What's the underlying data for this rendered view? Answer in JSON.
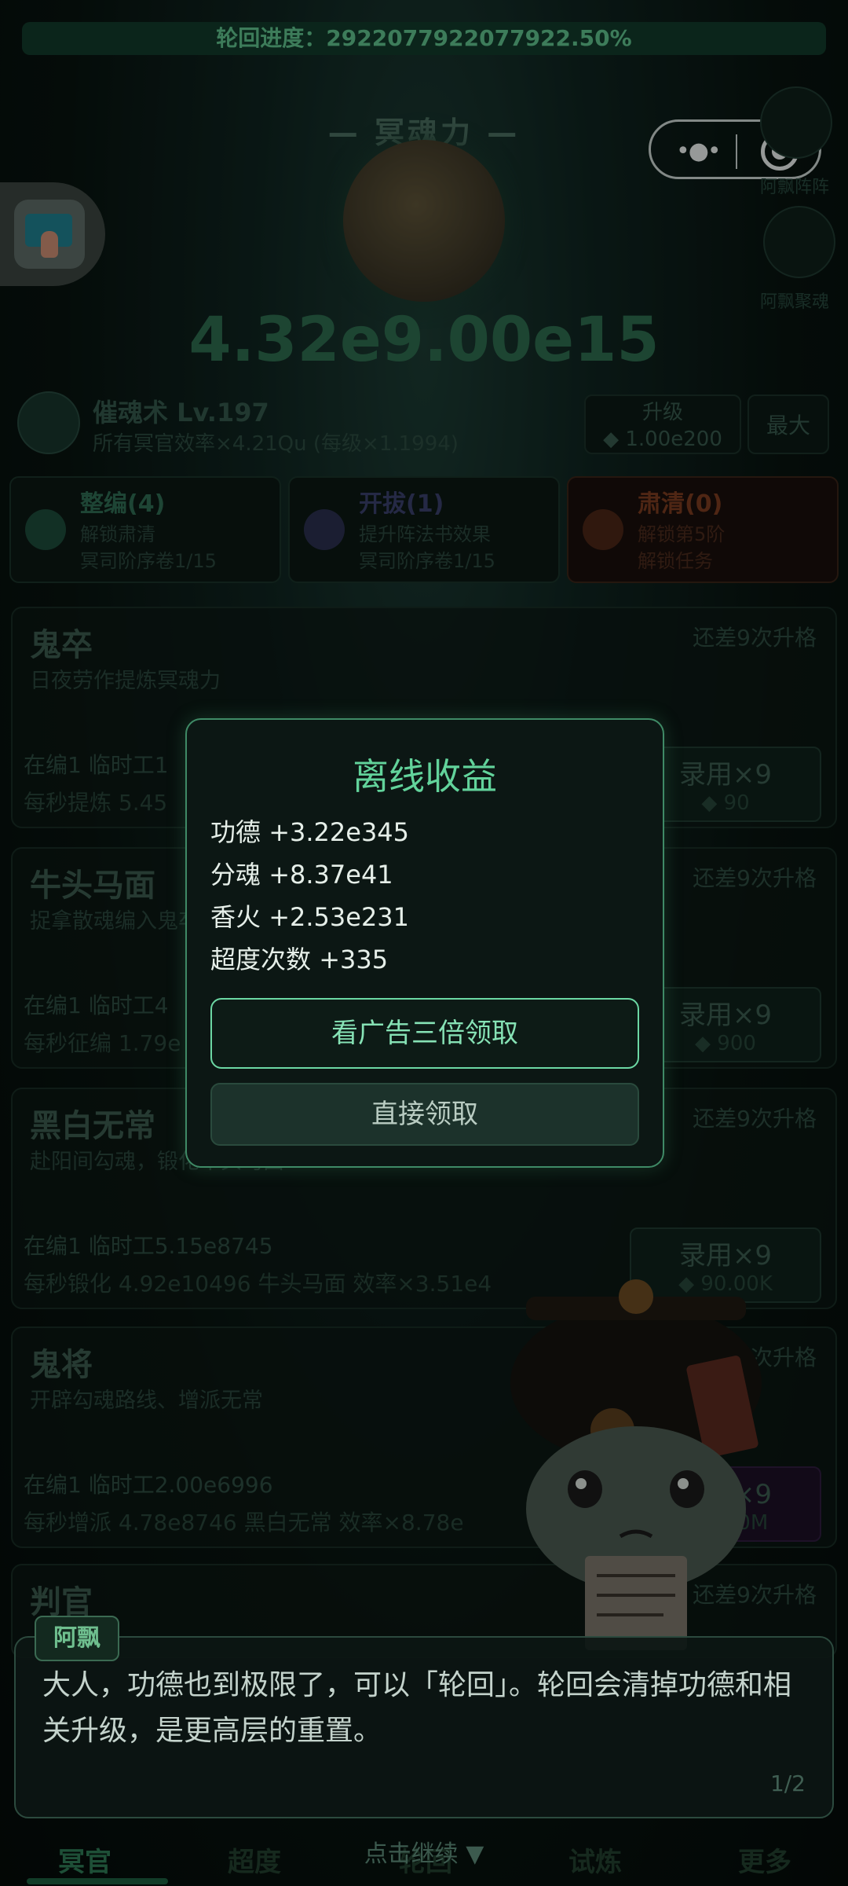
{
  "top_progress": "轮回进度：2922077922077922.50%",
  "hero": {
    "title": "— 冥魂力 —",
    "value": "4.32e9.00e15"
  },
  "side_icons": [
    {
      "label": "阿飘阵阵"
    },
    {
      "label": "阿飘聚魂"
    }
  ],
  "skill": {
    "name": "催魂术 Lv.197",
    "desc": "所有冥官效率×4.21Qu (每级×1.1994)",
    "upgrade_label": "升级",
    "upgrade_cost": "◆ 1.00e200",
    "max_label": "最大"
  },
  "cards": [
    {
      "title": "整编(4)",
      "line1": "解锁肃清",
      "line2": "冥司阶序卷1/15",
      "color": "#2f6b52"
    },
    {
      "title": "开拔(1)",
      "line1": "提升阵法书效果",
      "line2": "冥司阶序卷1/15",
      "color": "#3a3f6b"
    },
    {
      "title": "肃清(0)",
      "line1": "解锁第5阶",
      "line2": "解锁任务",
      "color": "#7a3b1f"
    }
  ],
  "units": [
    {
      "name": "鬼卒",
      "desc": "日夜劳作提炼冥魂力",
      "need": "还差9次升格",
      "line1": "在编1 临时工1",
      "line2": "每秒提炼 5.45",
      "hire": "录用×9",
      "cost": "◆ 90"
    },
    {
      "name": "牛头马面",
      "desc": "捉拿散魂编入鬼卒",
      "need": "还差9次升格",
      "line1": "在编1 临时工4",
      "line2": "每秒征编 1.79e",
      "hire": "录用×9",
      "cost": "◆ 900"
    },
    {
      "name": "黑白无常",
      "desc": "赴阳间勾魂，锻化牛头马面",
      "need": "还差9次升格",
      "line1": "在编1 临时工5.15e8745",
      "line2": "每秒锻化 4.92e10496 牛头马面 效率×3.51e4",
      "hire": "录用×9",
      "cost": "◆ 90.00K"
    },
    {
      "name": "鬼将",
      "desc": "开辟勾魂路线、增派无常",
      "need": "还差9次升格",
      "line1": "在编1 临时工2.00e6996",
      "line2": "每秒增派 4.78e8746 黑白无常 效率×8.78e",
      "hire": "录用×9",
      "cost": "◆ 9.00M"
    },
    {
      "name": "判官",
      "desc": "",
      "need": "还差9次升格",
      "line1": "",
      "line2": "",
      "hire": "",
      "cost": ""
    }
  ],
  "dialog": {
    "title": "离线收益",
    "rows": [
      {
        "label": "功德",
        "value": "+3.22e345"
      },
      {
        "label": "分魂",
        "value": "+8.37e41"
      },
      {
        "label": "香火",
        "value": "+2.53e231"
      },
      {
        "label": "超度次数",
        "value": "+335"
      }
    ],
    "ad_button": "看广告三倍领取",
    "claim_button": "直接领取"
  },
  "speech": {
    "speaker": "阿飘",
    "text": "大人，功德也到极限了，可以「轮回」。轮回会清掉功德和相关升级，是更高层的重置。",
    "page": "1/2",
    "continue_hint": "点击继续 ▼"
  },
  "nav": [
    "冥官",
    "超度",
    "轮回",
    "试炼",
    "更多"
  ]
}
